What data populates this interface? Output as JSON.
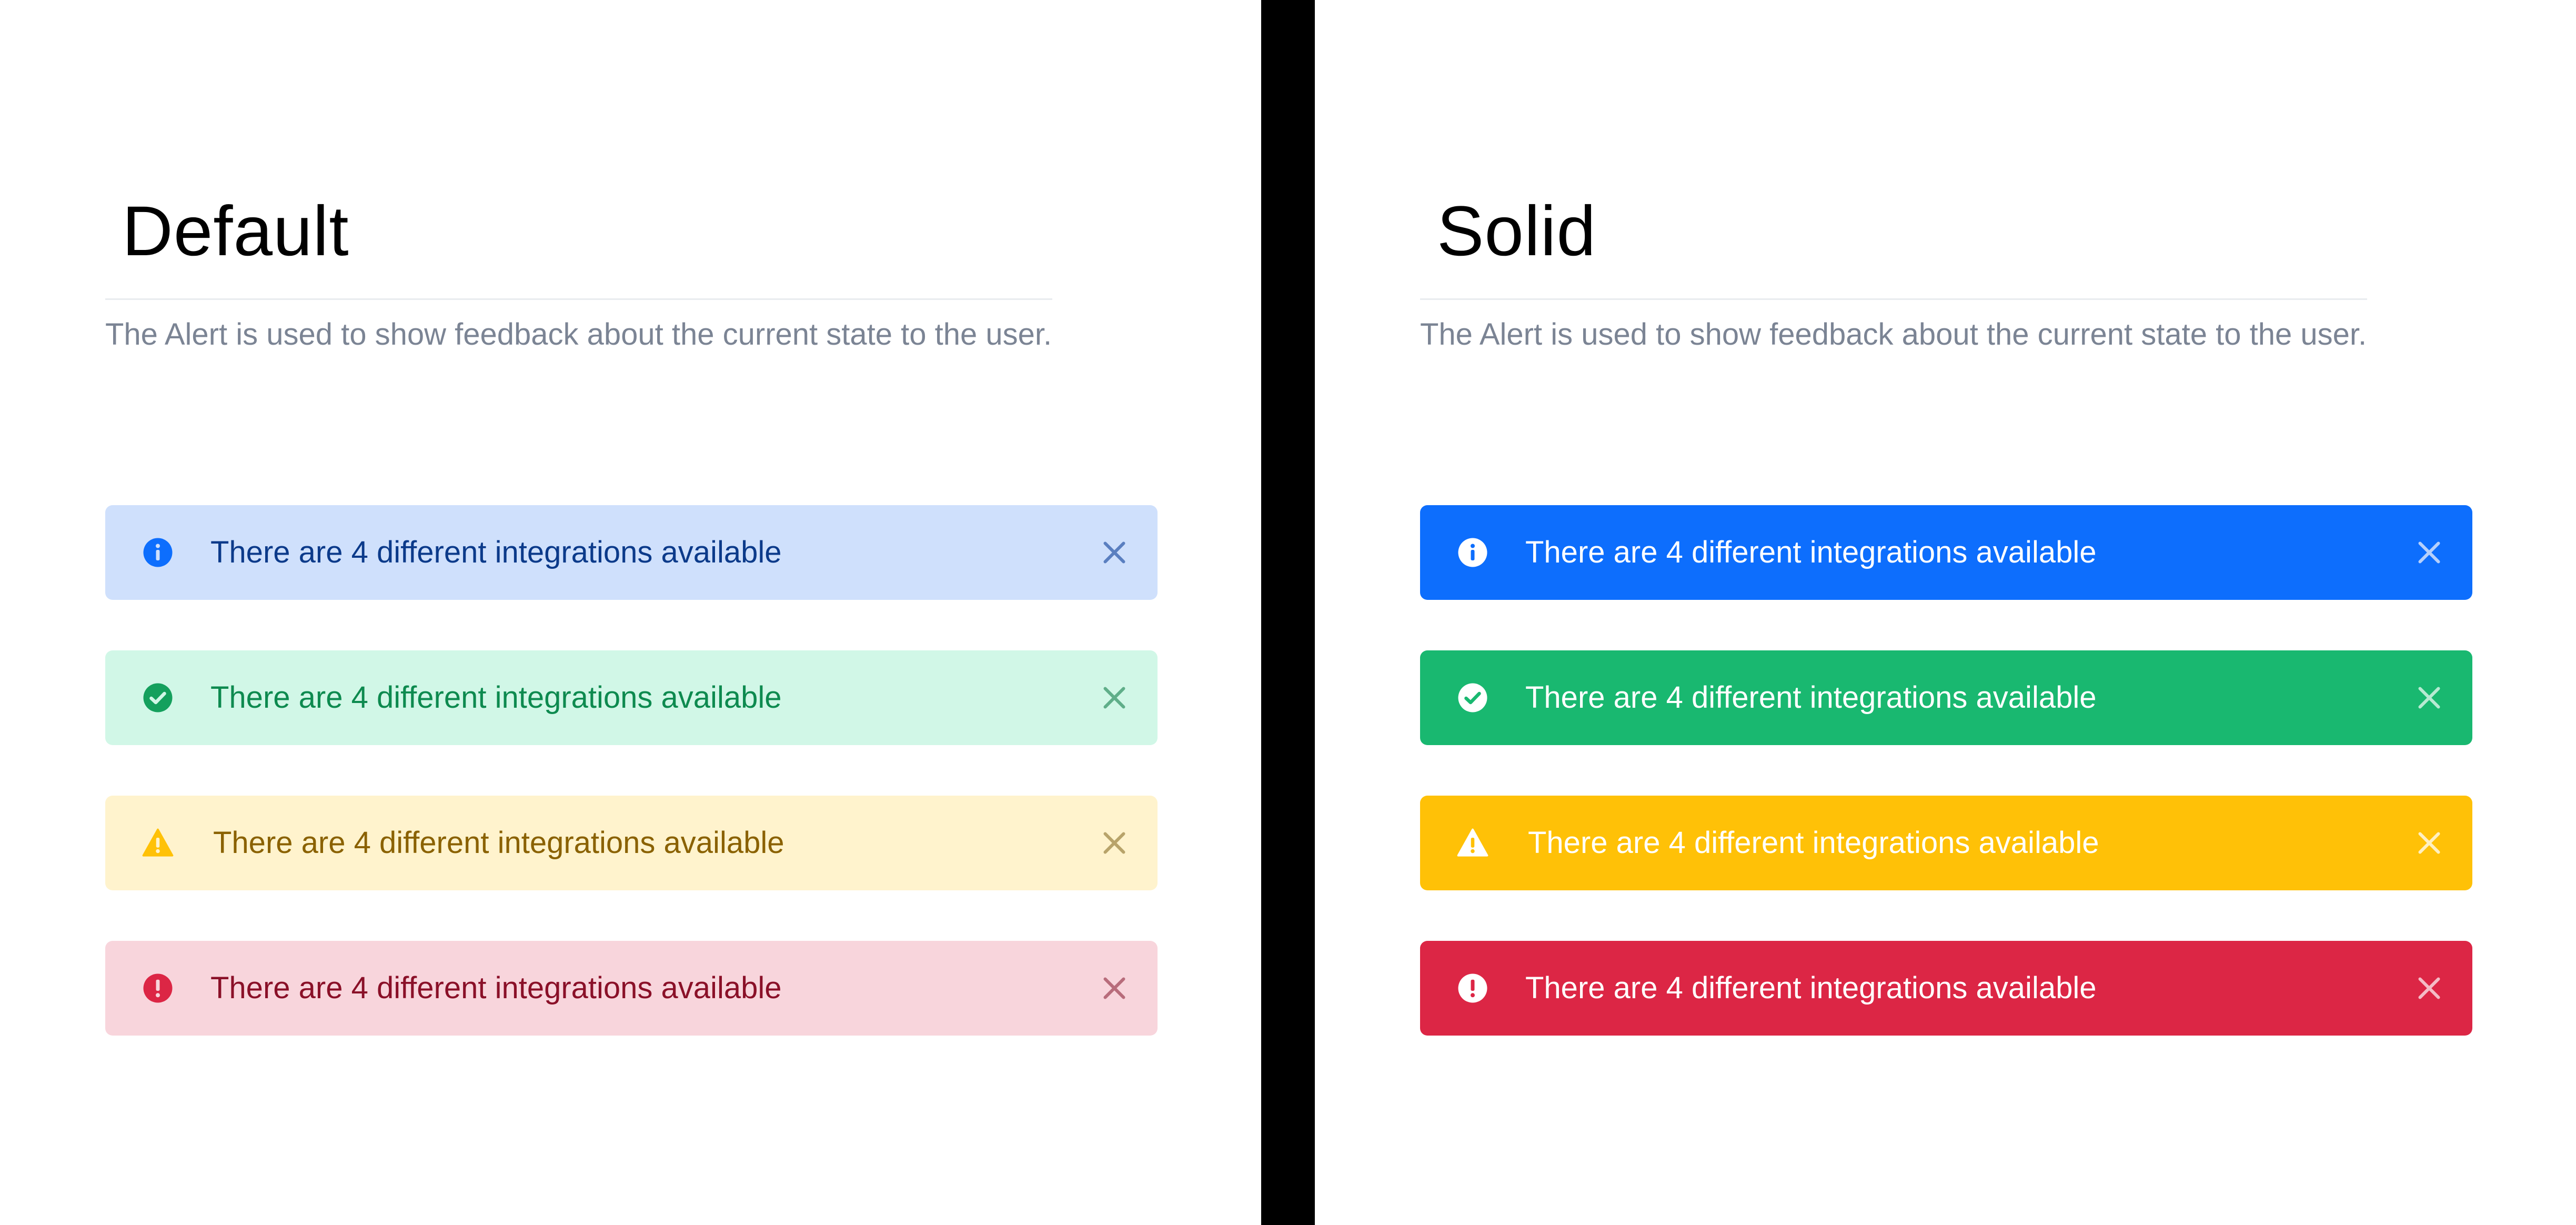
{
  "panels": {
    "default": {
      "title": "Default",
      "description": "The Alert is used to show feedback about the current state to the user.",
      "alerts": [
        {
          "type": "info",
          "icon": "info-icon",
          "message": "There are 4 different integrations available",
          "bg": "#cfe0fc",
          "text": "#0b3a8a",
          "icon_color": "#0d6efd",
          "close_color": "#5a7fc0"
        },
        {
          "type": "success",
          "icon": "check-circle-icon",
          "message": "There are 4 different integrations available",
          "bg": "#d1f7e7",
          "text": "#0d8a4f",
          "icon_color": "#14a05d",
          "close_color": "#5fae89"
        },
        {
          "type": "warning",
          "icon": "warning-triangle-icon",
          "message": "There are 4 different integrations available",
          "bg": "#fff3cd",
          "text": "#8a6100",
          "icon_color": "#ffc107",
          "close_color": "#b8a36a"
        },
        {
          "type": "danger",
          "icon": "exclamation-circle-icon",
          "message": "There are 4 different integrations available",
          "bg": "#f8d5dc",
          "text": "#8a1028",
          "icon_color": "#dc2645",
          "close_color": "#b86c7b"
        }
      ]
    },
    "solid": {
      "title": "Solid",
      "description": "The Alert is used to show feedback about the current state to the user.",
      "alerts": [
        {
          "type": "info",
          "icon": "info-icon",
          "message": "There are 4 different integrations available",
          "bg": "#0d6efd",
          "text": "#ffffff",
          "icon_color": "#ffffff",
          "close_color": "#b6d0fb"
        },
        {
          "type": "success",
          "icon": "check-circle-icon",
          "message": "There are 4 different integrations available",
          "bg": "#19b870",
          "text": "#ffffff",
          "icon_color": "#ffffff",
          "close_color": "#b7ead2"
        },
        {
          "type": "warning",
          "icon": "warning-triangle-icon",
          "message": "There are 4 different integrations available",
          "bg": "#ffc107",
          "text": "#ffffff",
          "icon_color": "#ffffff",
          "close_color": "#fff0c0"
        },
        {
          "type": "danger",
          "icon": "exclamation-circle-icon",
          "message": "There are 4 different integrations available",
          "bg": "#dc2645",
          "text": "#ffffff",
          "icon_color": "#ffffff",
          "close_color": "#f4bcc6"
        }
      ]
    }
  }
}
